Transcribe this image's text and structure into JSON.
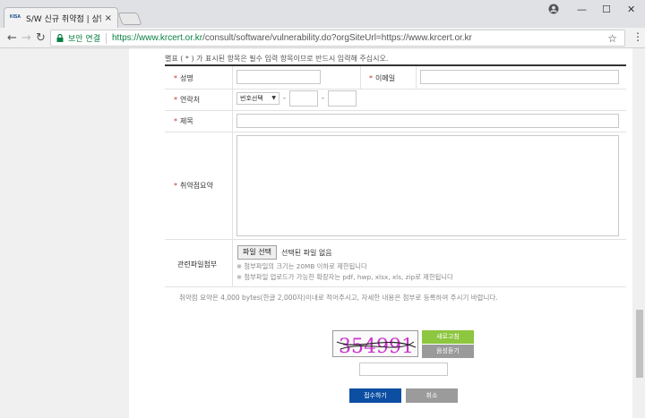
{
  "browser": {
    "tab_title": "S/W 신규 취약점 | 상담",
    "tab_favicon": "KISA",
    "secure_label": "보안 연결",
    "url_host": "https://www.krcert.or.kr",
    "url_rest": "/consult/software/vulnerability.do?orgSiteUrl=https://www.krcert.or.kr",
    "icons": [
      "back-icon",
      "forward-icon",
      "reload-icon",
      "lock-icon",
      "star-icon",
      "menu-icon",
      "account-icon",
      "minimize-icon",
      "maximize-icon",
      "close-icon"
    ]
  },
  "form": {
    "notice": "별표 ( * ) 가 표시된 항목은 필수 입력 항목이므로 반드시 입력해 주십시오.",
    "required_mark": "*",
    "name_label": "성명",
    "email_label": "이메일",
    "contact_label": "연락처",
    "phone_select": "번호선택",
    "phone_sep": "-",
    "subject_label": "제목",
    "summary_label": "취약점요약",
    "attach_label": "관련파일첨부",
    "file_button": "파일 선택",
    "file_none": "선택된 파일 없음",
    "hint_size": "※ 첨부파일의 크기는 20MB 이하로 제한됩니다",
    "hint_ext": "※ 첨부파일 업로드가 가능한 확장자는 pdf, hwp, xlsx, xls, zip로 제한됩니다",
    "bottom_note": "취약점 요약은 4,000 bytes(한글 2,000자)이내로 적어주시고, 자세한 내용은 첨부로 등록하여 주시기 바랍니다."
  },
  "captcha": {
    "code": "354991",
    "refresh_label": "새로고침",
    "audio_label": "음성듣기"
  },
  "actions": {
    "submit_label": "접수하기",
    "cancel_label": "취소"
  },
  "colors": {
    "captcha_refresh": "#8dc63f",
    "captcha_audio": "#9a9a9a",
    "submit": "#0b4ea2",
    "cancel": "#9b9b9b",
    "required": "#c0392b",
    "secure": "#0b8043"
  }
}
